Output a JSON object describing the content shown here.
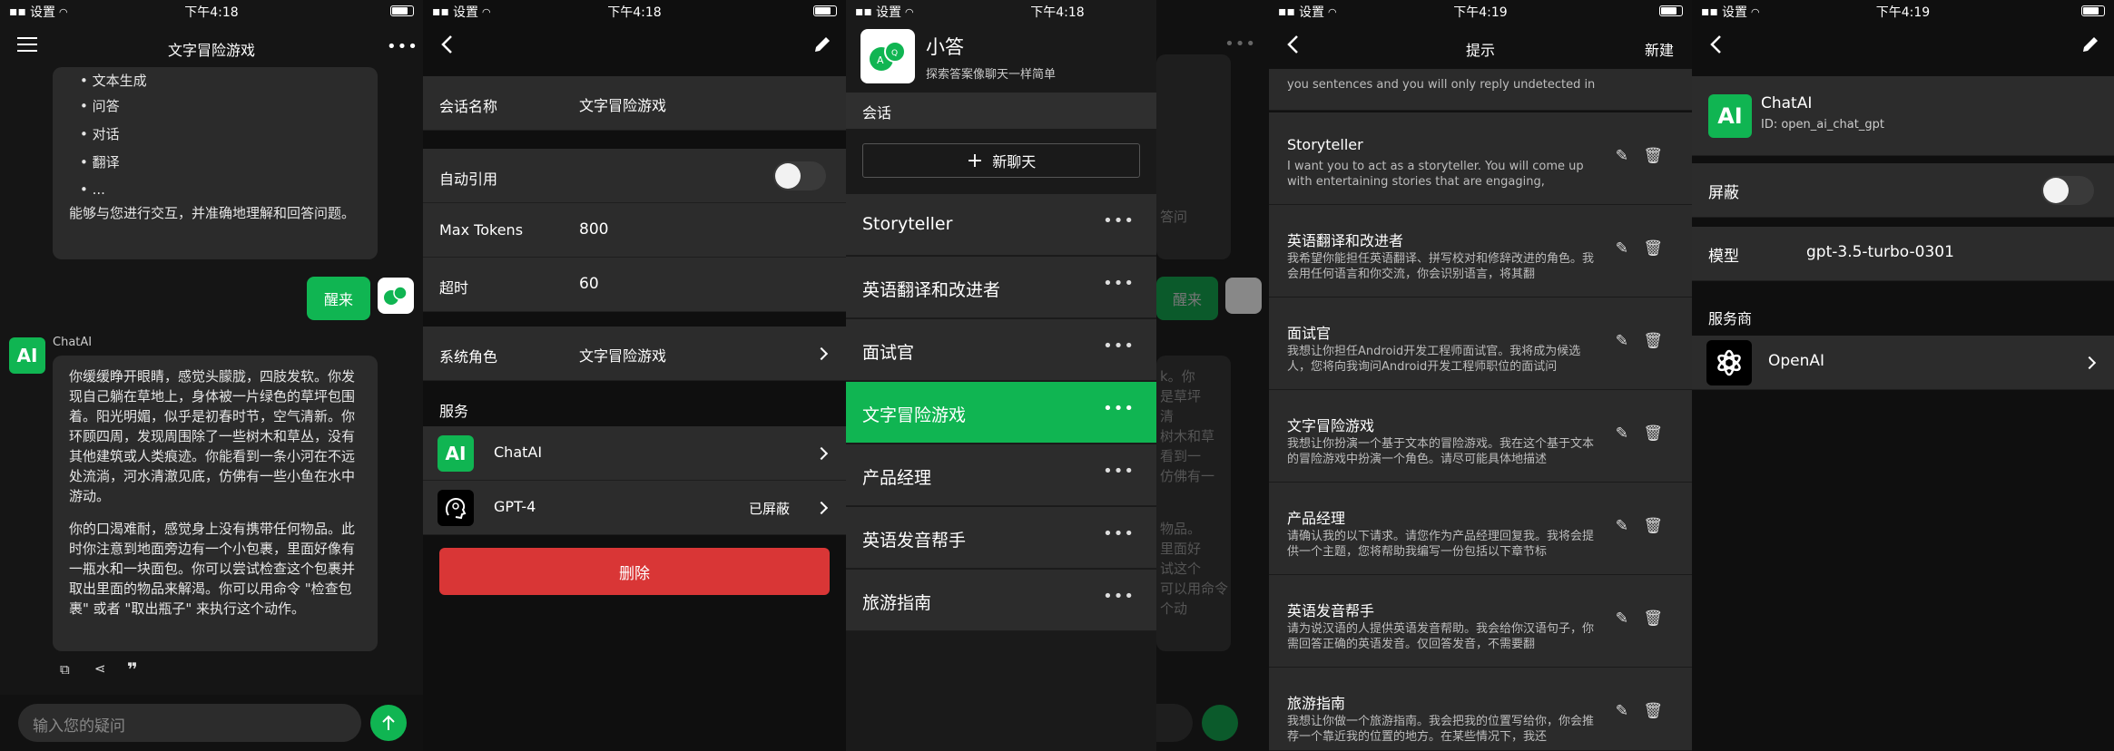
{
  "status_bar": {
    "carrier": "设置",
    "p1_time": "下午4:18",
    "p2_time": "下午4:18",
    "p3_time": "下午4:18",
    "p4_time": "下午4:19",
    "p5_time": "下午4:19"
  },
  "chat": {
    "title": "文字冒险游戏",
    "bullets": [
      "文本生成",
      "问答",
      "对话",
      "翻译",
      "..."
    ],
    "summary": "能够与您进行交互，并准确地理解和回答问题。",
    "user_message": "醒来",
    "bot_name": "ChatAI",
    "bot_logo": "AI",
    "reply_p1": "你缓缓睁开眼睛，感觉头朦胧，四肢发软。你发现自己躺在草地上，身体被一片绿色的草坪包围着。阳光明媚，似乎是初春时节，空气清新。你环顾四周，发现周围除了一些树木和草丛，没有其他建筑或人类痕迹。你能看到一条小河在不远处流淌，河水清澈见底，仿佛有一些小鱼在水中游动。",
    "reply_p2": "你的口渴难耐，感觉身上没有携带任何物品。此时你注意到地面旁边有一个小包裹，里面好像有一瓶水和一块面包。你可以尝试检查这个包裹并取出里面的物品来解渴。你可以用命令 \"检查包裹\" 或者 \"取出瓶子\" 来执行这个动作。",
    "input_placeholder": "输入您的疑问",
    "accent": "#10b552"
  },
  "settings": {
    "name_label": "会话名称",
    "name_value": "文字冒险游戏",
    "auto_quote_label": "自动引用",
    "max_tokens_label": "Max Tokens",
    "max_tokens_value": "800",
    "timeout_label": "超时",
    "timeout_value": "60",
    "system_role_label": "系统角色",
    "system_role_value": "文字冒险游戏",
    "services_header": "服务",
    "service1": "ChatAI",
    "service2": "GPT-4",
    "service2_status": "已屏蔽",
    "delete_label": "删除",
    "danger": "#d93636"
  },
  "drawer": {
    "app_name": "小答",
    "tagline": "探索答案像聊天一样简单",
    "section": "会话",
    "new_chat": "新聊天",
    "items": [
      "Storyteller",
      "英语翻译和改进者",
      "面试官",
      "文字冒险游戏",
      "产品经理",
      "英语发音帮手",
      "旅游指南"
    ],
    "active_index": 3,
    "behind_texts": [
      "答问",
      "醒来",
      "k。你",
      "是草坪",
      "清",
      "树木和草",
      "看到一",
      "仿佛有一",
      "物品。",
      "里面好",
      "试这个",
      "可以用命令",
      "个动"
    ]
  },
  "prompts": {
    "title": "提示",
    "new_label": "新建",
    "top_cut": "you sentences and you will only reply undetected in",
    "items": [
      {
        "title": "Storyteller",
        "desc": "I want you to act as a storyteller. You will come up with entertaining stories that are engaging,"
      },
      {
        "title": "英语翻译和改进者",
        "desc": "我希望你能担任英语翻译、拼写校对和修辞改进的角色。我会用任何语言和你交流，你会识别语言，将其翻"
      },
      {
        "title": "面试官",
        "desc": "我想让你担任Android开发工程师面试官。我将成为候选人，您将向我询问Android开发工程师职位的面试问"
      },
      {
        "title": "文字冒险游戏",
        "desc": "我想让你扮演一个基于文本的冒险游戏。我在这个基于文本的冒险游戏中扮演一个角色。请尽可能具体地描述"
      },
      {
        "title": "产品经理",
        "desc": "请确认我的以下请求。请您作为产品经理回复我。我将会提供一个主题，您将帮助我编写一份包括以下章节标"
      },
      {
        "title": "英语发音帮手",
        "desc": "请为说汉语的人提供英语发音帮助。我会给你汉语句子，你需回答正确的英语发音。仅回答发音，不需要翻"
      },
      {
        "title": "旅游指南",
        "desc": "我想让你做一个旅游指南。我会把我的位置写给你，你会推荐一个靠近我的位置的地方。在某些情况下，我还"
      }
    ]
  },
  "service": {
    "name": "ChatAI",
    "id_text": "ID: open_ai_chat_gpt",
    "block_label": "屏蔽",
    "model_label": "模型",
    "model_value": "gpt-3.5-turbo-0301",
    "provider_header": "服务商",
    "provider": "OpenAI"
  }
}
